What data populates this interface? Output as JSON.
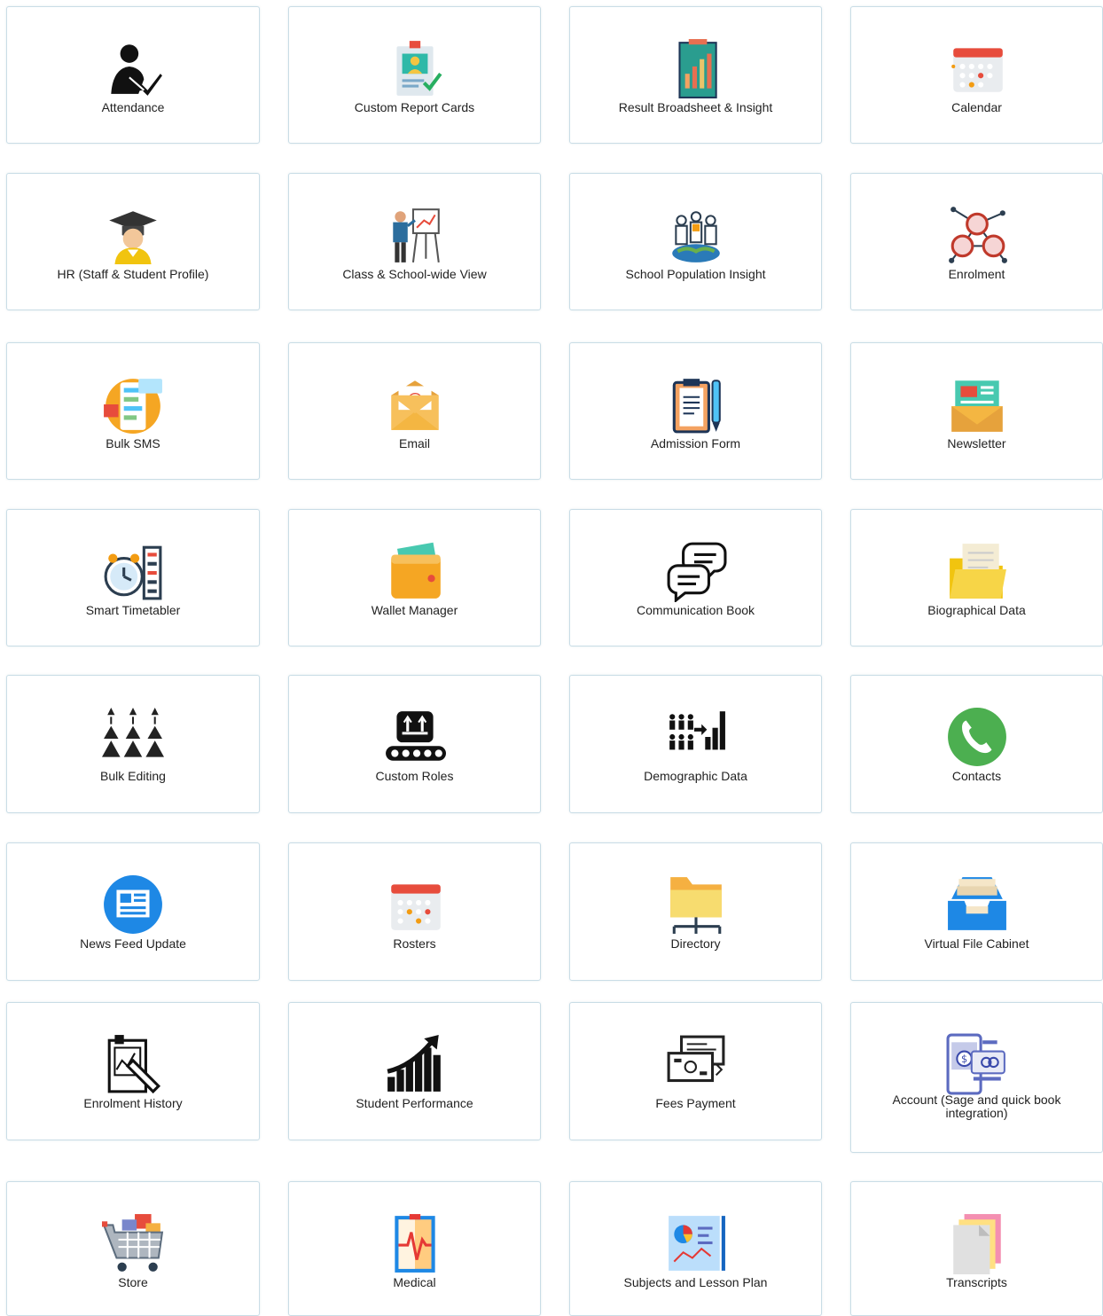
{
  "tiles": [
    {
      "label": "Attendance",
      "icon": "attendance-icon"
    },
    {
      "label": "Custom Report Cards",
      "icon": "report-card-icon"
    },
    {
      "label": "Result Broadsheet & Insight",
      "icon": "bar-chart-icon"
    },
    {
      "label": "Calendar",
      "icon": "calendar-icon"
    },
    {
      "label": "HR (Staff & Student Profile)",
      "icon": "graduate-icon"
    },
    {
      "label": "Class & School-wide View",
      "icon": "teacher-board-icon"
    },
    {
      "label": "School Population Insight",
      "icon": "population-globe-icon"
    },
    {
      "label": "Enrolment",
      "icon": "network-people-icon"
    },
    {
      "label": "Bulk SMS",
      "icon": "chat-bubbles-icon"
    },
    {
      "label": "Email",
      "icon": "email-envelope-icon"
    },
    {
      "label": "Admission Form",
      "icon": "clipboard-pen-icon"
    },
    {
      "label": "Newsletter",
      "icon": "newsletter-envelope-icon"
    },
    {
      "label": "Smart Timetabler",
      "icon": "clock-schedule-icon"
    },
    {
      "label": "Wallet Manager",
      "icon": "wallet-icon"
    },
    {
      "label": "Communication Book",
      "icon": "speech-bubbles-icon"
    },
    {
      "label": "Biographical Data",
      "icon": "folder-documents-icon"
    },
    {
      "label": "Bulk Editing",
      "icon": "pyramids-icon"
    },
    {
      "label": "Custom Roles",
      "icon": "conveyor-icon"
    },
    {
      "label": "Demographic Data",
      "icon": "people-chart-icon"
    },
    {
      "label": "Contacts",
      "icon": "phone-icon"
    },
    {
      "label": "News Feed Update",
      "icon": "news-icon"
    },
    {
      "label": "Rosters",
      "icon": "roster-calendar-icon"
    },
    {
      "label": "Directory",
      "icon": "folder-tree-icon"
    },
    {
      "label": "Virtual File Cabinet",
      "icon": "file-tray-icon"
    },
    {
      "label": "Enrolment History",
      "icon": "document-history-icon"
    },
    {
      "label": "Student Performance",
      "icon": "growth-chart-icon"
    },
    {
      "label": "Fees Payment",
      "icon": "money-icon"
    },
    {
      "label": "Account (Sage and quick book integration)",
      "icon": "account-cards-icon"
    },
    {
      "label": "Store",
      "icon": "shopping-cart-icon"
    },
    {
      "label": "Medical",
      "icon": "medical-chart-icon"
    },
    {
      "label": "Subjects and Lesson Plan",
      "icon": "lesson-board-icon"
    },
    {
      "label": "Transcripts",
      "icon": "paper-stack-icon"
    }
  ]
}
